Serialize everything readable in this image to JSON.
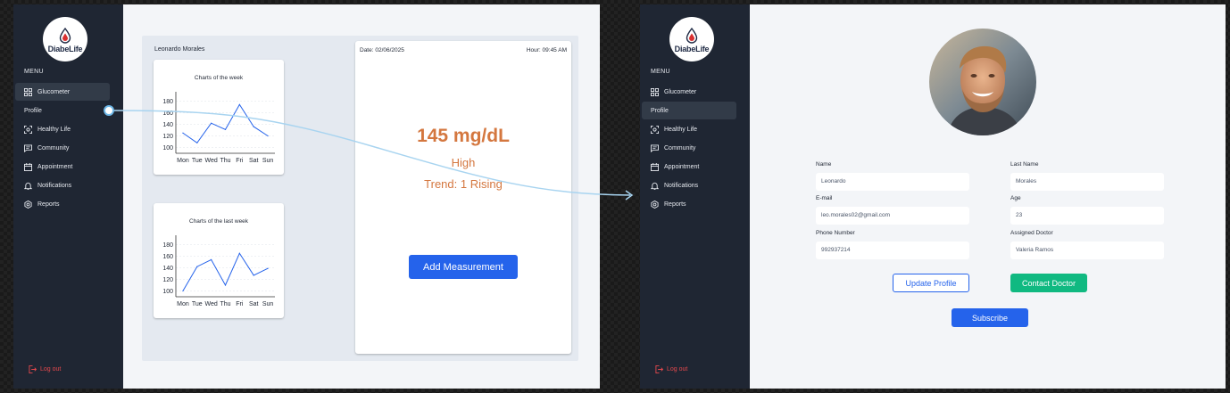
{
  "brand": {
    "name": "DiabeLife"
  },
  "sidebar": {
    "menu_label": "MENU",
    "items": [
      {
        "label": "Glucometer",
        "icon": "grid-icon"
      },
      {
        "label": "Profile",
        "icon": "user-icon"
      },
      {
        "label": "Healthy Life",
        "icon": "scan-icon"
      },
      {
        "label": "Community",
        "icon": "chat-icon"
      },
      {
        "label": "Appointment",
        "icon": "calendar-icon"
      },
      {
        "label": "Notifications",
        "icon": "bell-icon"
      },
      {
        "label": "Reports",
        "icon": "settings-icon"
      }
    ],
    "logout_label": "Log out"
  },
  "glucometer": {
    "patient_name": "Leonardo Morales",
    "reading": {
      "date": "Date: 02/06/2025",
      "hour": "Hour: 09:45 AM",
      "value": "145 mg/dL",
      "status": "High",
      "trend": "Trend: 1 Rising"
    },
    "add_button": "Add Measurement"
  },
  "chart_data": [
    {
      "type": "line",
      "title": "Charts of the week",
      "categories": [
        "Mon",
        "Tue",
        "Wed",
        "Thu",
        "Fri",
        "Sat",
        "Sun"
      ],
      "values": [
        125,
        108,
        142,
        131,
        174,
        136,
        120
      ],
      "yticks": [
        100,
        120,
        140,
        160,
        180
      ],
      "ylim": [
        90,
        190
      ],
      "color": "#2563eb",
      "grid": true
    },
    {
      "type": "line",
      "title": "Charts of the last week",
      "categories": [
        "Mon",
        "Tue",
        "Wed",
        "Thu",
        "Fri",
        "Sat",
        "Sun"
      ],
      "values": [
        100,
        142,
        154,
        110,
        165,
        127,
        139
      ],
      "yticks": [
        100,
        120,
        140,
        160,
        180
      ],
      "ylim": [
        90,
        190
      ],
      "color": "#2563eb",
      "grid": true
    }
  ],
  "profile": {
    "fields": {
      "name": {
        "label": "Name",
        "value": "Leonardo"
      },
      "last_name": {
        "label": "Last Name",
        "value": "Morales"
      },
      "email": {
        "label": "E-mail",
        "value": "leo.morales02@gmail.com"
      },
      "age": {
        "label": "Age",
        "value": "23"
      },
      "phone": {
        "label": "Phone Number",
        "value": "992937214"
      },
      "doctor": {
        "label": "Assigned Doctor",
        "value": "Valeria Ramos"
      }
    },
    "update_button": "Update Profile",
    "contact_button": "Contact Doctor",
    "subscribe_button": "Subscribe"
  },
  "colors": {
    "sidebar_bg": "#1f2633",
    "accent": "#2563eb",
    "reading": "#d4773f",
    "contact": "#10b981",
    "logout": "#e5484d"
  }
}
